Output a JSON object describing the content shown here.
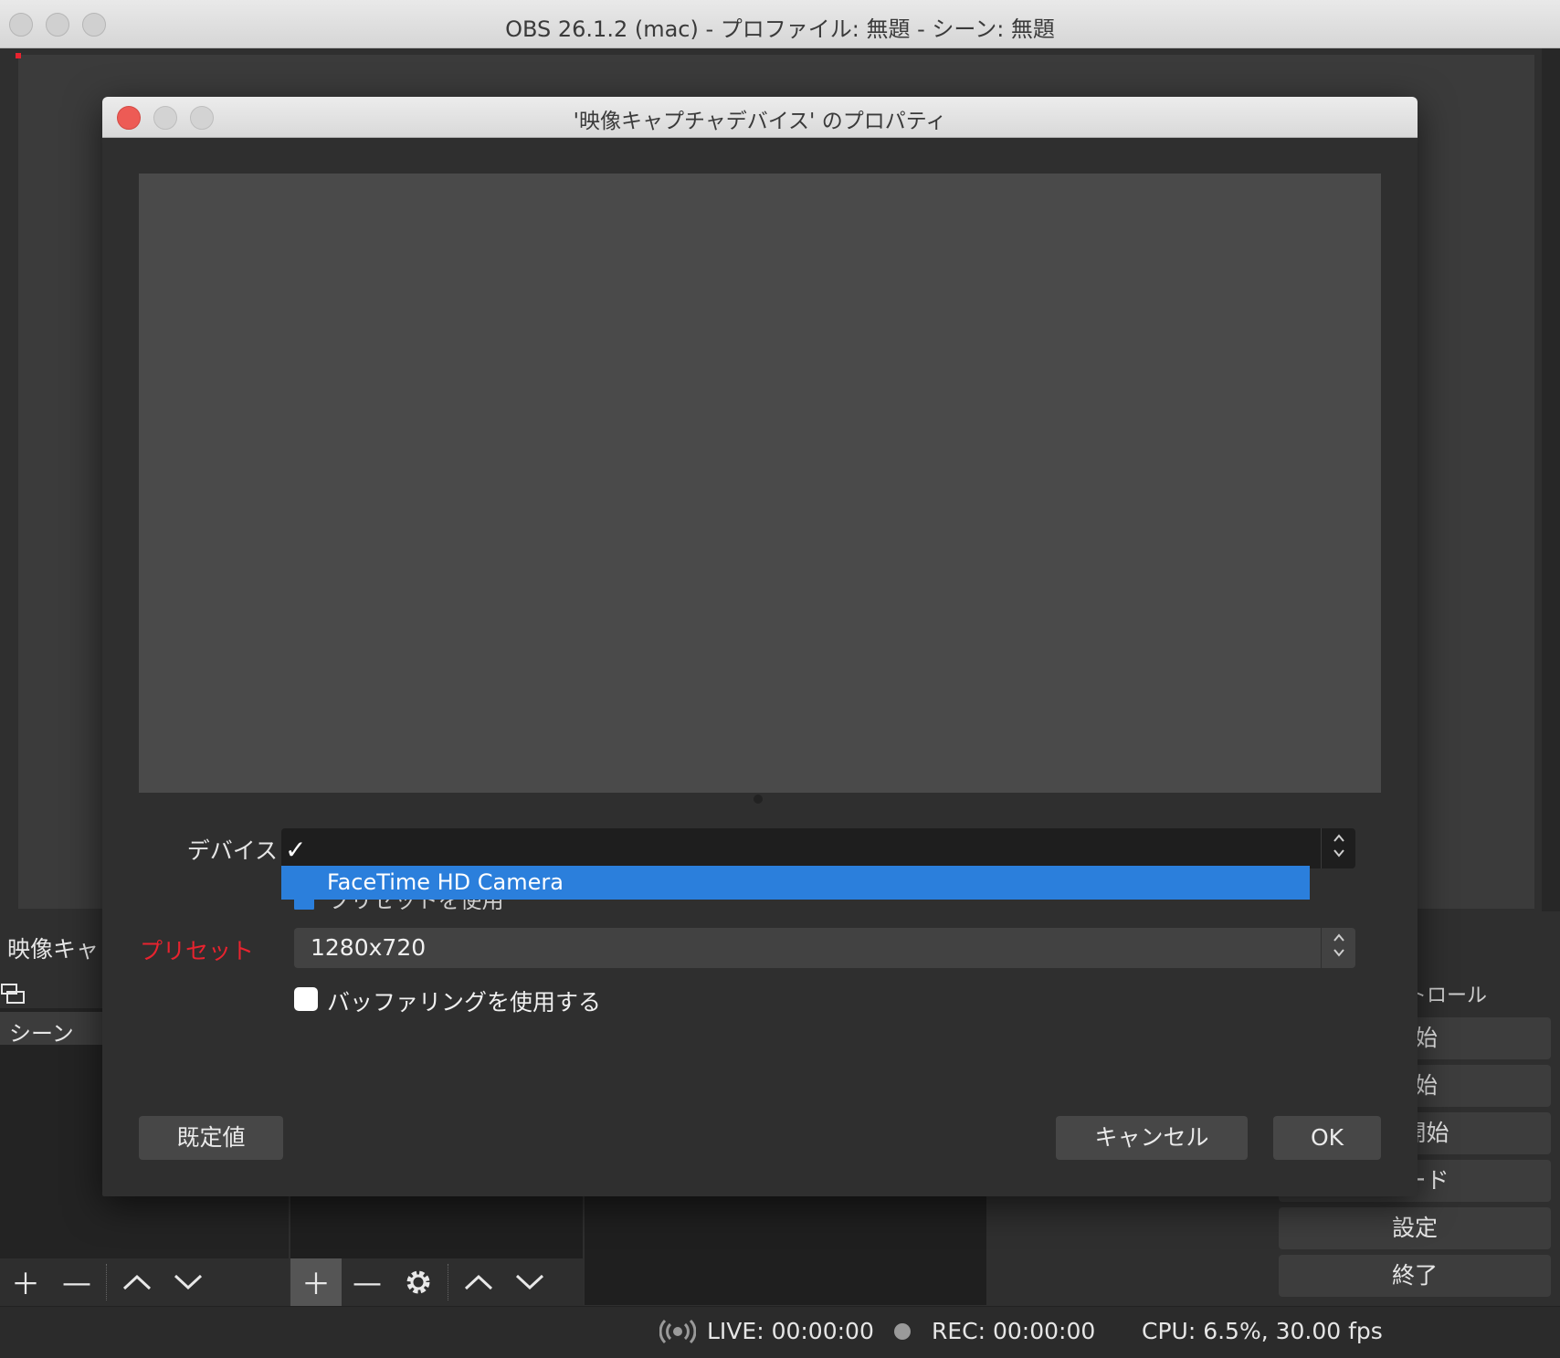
{
  "main_window": {
    "title": "OBS 26.1.2 (mac) - プロファイル: 無題 - シーン: 無題"
  },
  "docks": {
    "scenes_title": "映像キャ",
    "scene_item": "シーン",
    "controls_title": "トロール",
    "controls_buttons": [
      "開始",
      "開始",
      "ラ開始",
      "モード",
      "設定",
      "終了"
    ]
  },
  "status_bar": {
    "live": "LIVE: 00:00:00",
    "rec": "REC: 00:00:00",
    "cpu": "CPU: 6.5%, 30.00 fps"
  },
  "dialog": {
    "title": "'映像キャプチャデバイス' のプロパティ",
    "device_label": "デバイス",
    "device_check": "✓",
    "device_option": "FaceTime HD Camera",
    "hidden_row_text": "プリセットを使用",
    "preset_label": "プリセット",
    "preset_value": "1280x720",
    "buffer_label": "バッファリングを使用する",
    "defaults_button": "既定値",
    "cancel_button": "キャンセル",
    "ok_button": "OK"
  },
  "colors": {
    "accent_blue": "#2b7fdc",
    "preset_red": "#e8232f",
    "close_red": "#ed5b55"
  }
}
